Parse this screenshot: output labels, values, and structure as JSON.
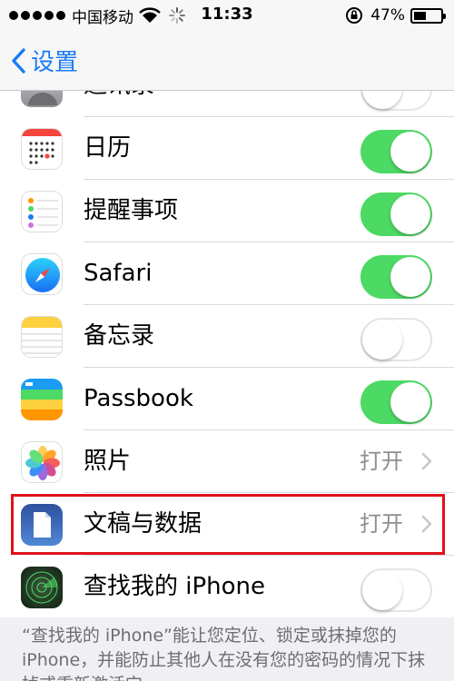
{
  "status": {
    "carrier": "中国移动",
    "time": "11:33",
    "battery": "47%",
    "battery_level": 0.47
  },
  "nav": {
    "back_label": "设置"
  },
  "rows": [
    {
      "label": "通讯录",
      "icon": "contacts-icon",
      "control": "toggle",
      "on": false
    },
    {
      "label": "日历",
      "icon": "calendar-icon",
      "control": "toggle",
      "on": true
    },
    {
      "label": "提醒事项",
      "icon": "reminders-icon",
      "control": "toggle",
      "on": true
    },
    {
      "label": "Safari",
      "icon": "safari-icon",
      "control": "toggle",
      "on": true
    },
    {
      "label": "备忘录",
      "icon": "notes-icon",
      "control": "toggle",
      "on": false
    },
    {
      "label": "Passbook",
      "icon": "passbook-icon",
      "control": "toggle",
      "on": true
    },
    {
      "label": "照片",
      "icon": "photos-icon",
      "control": "detail",
      "detail": "打开"
    },
    {
      "label": "文稿与数据",
      "icon": "documents-icon",
      "control": "detail",
      "detail": "打开"
    },
    {
      "label": "查找我的 iPhone",
      "icon": "find-my-iphone-icon",
      "control": "toggle",
      "on": false
    }
  ],
  "footer_text": "“查找我的 iPhone”能让您定位、锁定或抹掉您的 iPhone，并能防止其他人在没有您的密码的情况下抹掉或重新激活它。",
  "colors": {
    "accent": "#1a7cf5",
    "toggle_on": "#4cd964",
    "highlight": "#e0111b"
  }
}
